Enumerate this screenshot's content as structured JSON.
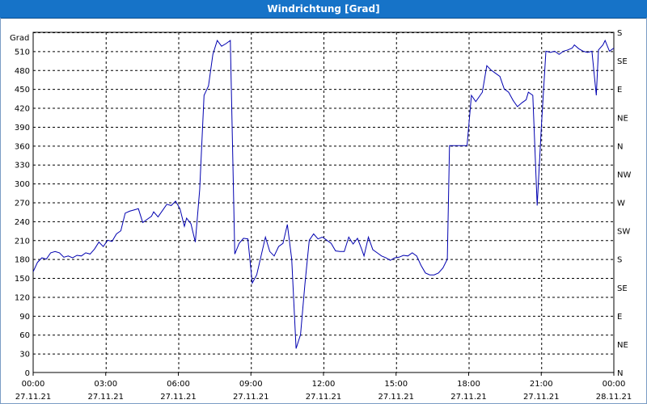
{
  "window": {
    "title": "Windrichtung [Grad]"
  },
  "chart_data": {
    "type": "line",
    "title": "Windrichtung [Grad]",
    "ylabel": "Grad",
    "xlabel": "",
    "ylim": [
      0,
      540
    ],
    "xlim_hours": [
      0,
      24
    ],
    "grid": true,
    "y_ticks": [
      0,
      30,
      60,
      90,
      120,
      150,
      180,
      210,
      240,
      270,
      300,
      330,
      360,
      390,
      420,
      450,
      480,
      510
    ],
    "right_ticks": [
      {
        "value": 0,
        "label": "N"
      },
      {
        "value": 45,
        "label": "NE"
      },
      {
        "value": 90,
        "label": "E"
      },
      {
        "value": 135,
        "label": "SE"
      },
      {
        "value": 180,
        "label": "S"
      },
      {
        "value": 225,
        "label": "SW"
      },
      {
        "value": 270,
        "label": "W"
      },
      {
        "value": 315,
        "label": "NW"
      },
      {
        "value": 360,
        "label": "N"
      },
      {
        "value": 405,
        "label": "NE"
      },
      {
        "value": 450,
        "label": "E"
      },
      {
        "value": 495,
        "label": "SE"
      },
      {
        "value": 540,
        "label": "S"
      }
    ],
    "x_ticks": [
      {
        "hour": 0,
        "time": "00:00",
        "date": "27.11.21"
      },
      {
        "hour": 3,
        "time": "03:00",
        "date": "27.11.21"
      },
      {
        "hour": 6,
        "time": "06:00",
        "date": "27.11.21"
      },
      {
        "hour": 9,
        "time": "09:00",
        "date": "27.11.21"
      },
      {
        "hour": 12,
        "time": "12:00",
        "date": "27.11.21"
      },
      {
        "hour": 15,
        "time": "15:00",
        "date": "27.11.21"
      },
      {
        "hour": 18,
        "time": "18:00",
        "date": "27.11.21"
      },
      {
        "hour": 21,
        "time": "21:00",
        "date": "27.11.21"
      },
      {
        "hour": 24,
        "time": "00:00",
        "date": "28.11.21"
      }
    ],
    "series": [
      {
        "color": "#0000b0",
        "points": [
          [
            0.0,
            160
          ],
          [
            0.2,
            175
          ],
          [
            0.4,
            182
          ],
          [
            0.6,
            180
          ],
          [
            0.8,
            190
          ],
          [
            1.0,
            192
          ],
          [
            1.2,
            190
          ],
          [
            1.4,
            183
          ],
          [
            1.6,
            185
          ],
          [
            1.8,
            182
          ],
          [
            2.0,
            186
          ],
          [
            2.2,
            185
          ],
          [
            2.4,
            190
          ],
          [
            2.6,
            188
          ],
          [
            2.8,
            196
          ],
          [
            3.0,
            207
          ],
          [
            3.2,
            200
          ],
          [
            3.4,
            210
          ],
          [
            3.6,
            208
          ],
          [
            3.8,
            220
          ],
          [
            4.0,
            225
          ],
          [
            4.2,
            253
          ],
          [
            4.4,
            256
          ],
          [
            4.6,
            258
          ],
          [
            4.8,
            260
          ],
          [
            5.0,
            238
          ],
          [
            5.2,
            243
          ],
          [
            5.4,
            248
          ],
          [
            5.5,
            255
          ],
          [
            5.7,
            247
          ],
          [
            5.9,
            257
          ],
          [
            6.1,
            267
          ],
          [
            6.3,
            265
          ],
          [
            6.5,
            272
          ],
          [
            6.7,
            260
          ],
          [
            6.9,
            232
          ],
          [
            7.0,
            245
          ],
          [
            7.2,
            236
          ],
          [
            7.4,
            207
          ],
          [
            7.6,
            290
          ],
          [
            7.8,
            440
          ],
          [
            8.0,
            455
          ],
          [
            8.2,
            505
          ],
          [
            8.4,
            527
          ],
          [
            8.6,
            518
          ],
          [
            8.8,
            522
          ],
          [
            9.0,
            527
          ],
          [
            9.2,
            188
          ],
          [
            9.4,
            205
          ],
          [
            9.6,
            213
          ],
          [
            9.8,
            212
          ],
          [
            10.0,
            142
          ],
          [
            10.2,
            155
          ],
          [
            10.4,
            185
          ],
          [
            10.6,
            215
          ],
          [
            10.8,
            192
          ],
          [
            11.0,
            185
          ],
          [
            11.2,
            200
          ],
          [
            11.4,
            205
          ],
          [
            11.6,
            235
          ],
          [
            11.8,
            180
          ],
          [
            12.0,
            38
          ],
          [
            12.2,
            60
          ],
          [
            12.4,
            140
          ],
          [
            12.6,
            210
          ],
          [
            12.8,
            220
          ],
          [
            13.0,
            212
          ],
          [
            13.2,
            215
          ],
          [
            13.4,
            210
          ],
          [
            13.6,
            205
          ],
          [
            13.8,
            193
          ],
          [
            14.0,
            192
          ],
          [
            14.2,
            192
          ],
          [
            14.4,
            215
          ],
          [
            14.6,
            204
          ],
          [
            14.8,
            213
          ],
          [
            15.0,
            195
          ],
          [
            15.1,
            185
          ],
          [
            15.3,
            215
          ],
          [
            15.5,
            195
          ],
          [
            15.7,
            190
          ],
          [
            15.9,
            185
          ],
          [
            16.1,
            182
          ],
          [
            16.3,
            178
          ],
          [
            16.5,
            182
          ],
          [
            16.7,
            183
          ],
          [
            16.9,
            186
          ],
          [
            17.1,
            185
          ],
          [
            17.3,
            190
          ],
          [
            17.5,
            185
          ],
          [
            17.7,
            170
          ],
          [
            17.9,
            158
          ],
          [
            18.1,
            155
          ],
          [
            18.3,
            155
          ],
          [
            18.5,
            158
          ],
          [
            18.7,
            166
          ],
          [
            18.9,
            180
          ],
          [
            19.0,
            360
          ],
          [
            19.8,
            360
          ],
          [
            20.0,
            440
          ],
          [
            20.2,
            430
          ],
          [
            20.5,
            445
          ],
          [
            20.7,
            487
          ],
          [
            20.9,
            480
          ],
          [
            21.1,
            475
          ],
          [
            21.3,
            470
          ],
          [
            21.5,
            450
          ],
          [
            21.7,
            445
          ],
          [
            21.9,
            432
          ],
          [
            22.1,
            422
          ],
          [
            22.3,
            428
          ],
          [
            22.5,
            433
          ],
          [
            22.6,
            445
          ],
          [
            22.8,
            440
          ],
          [
            23.0,
            265
          ],
          [
            23.2,
            395
          ],
          [
            23.4,
            510
          ],
          [
            23.6,
            508
          ],
          [
            23.8,
            510
          ],
          [
            24.0,
            505
          ],
          [
            24.2,
            510
          ],
          [
            24.4,
            512
          ],
          [
            24.6,
            515
          ],
          [
            24.7,
            520
          ],
          [
            24.9,
            514
          ],
          [
            25.1,
            510
          ],
          [
            25.3,
            508
          ],
          [
            25.5,
            510
          ],
          [
            25.7,
            440
          ],
          [
            25.8,
            512
          ],
          [
            26.0,
            520
          ],
          [
            26.1,
            527
          ],
          [
            26.3,
            510
          ],
          [
            26.5,
            515
          ]
        ]
      }
    ]
  }
}
